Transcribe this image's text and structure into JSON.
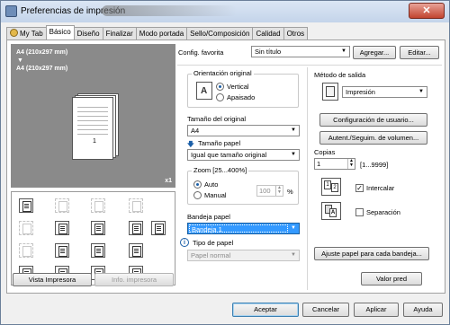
{
  "window": {
    "title": "Preferencias de impresión",
    "close_glyph": "✕"
  },
  "tabs": [
    {
      "label": "My Tab"
    },
    {
      "label": "Básico"
    },
    {
      "label": "Diseño"
    },
    {
      "label": "Finalizar"
    },
    {
      "label": "Modo portada"
    },
    {
      "label": "Sello/Composición"
    },
    {
      "label": "Calidad"
    },
    {
      "label": "Otros"
    }
  ],
  "preview": {
    "paper_line1": "A4 (210x297 mm)",
    "arrow": "▼",
    "paper_line2": "A4 (210x297 mm)",
    "page_number": "1",
    "copies_badge": "x1"
  },
  "left_buttons": {
    "printer_view": "Vista Impresora",
    "printer_info": "Info. impresora"
  },
  "favorite": {
    "label": "Config. favorita",
    "value": "Sin título",
    "add": "Agregar...",
    "edit": "Editar..."
  },
  "orientation": {
    "legend": "Orientación original",
    "vertical": "Vertical",
    "horizontal": "Apaisado",
    "selected": "vertical"
  },
  "original_size": {
    "label": "Tamaño del original",
    "value": "A4"
  },
  "paper_size": {
    "label": "Tamaño papel",
    "value": "Igual que tamaño original"
  },
  "zoom": {
    "legend": "Zoom [25...400%]",
    "auto": "Auto",
    "manual": "Manual",
    "value": "100",
    "unit": "%",
    "selected": "auto"
  },
  "tray": {
    "label": "Bandeja papel",
    "value": "Bandeja 1"
  },
  "paper_type": {
    "label": "Tipo de papel",
    "value": "Papel normal"
  },
  "output": {
    "label": "Método de salida",
    "value": "Impresión",
    "user_config": "Configuración de usuario...",
    "auth": "Autent./Seguim. de volumen..."
  },
  "copies": {
    "label": "Copias",
    "value": "1",
    "range": "[1...9999]",
    "collate_label": "Intercalar",
    "collate_checked": true,
    "separate_label": "Separación",
    "separate_checked": false
  },
  "adjust_button": "Ajuste papel para cada bandeja...",
  "default_button": "Valor pred",
  "bottom": {
    "ok": "Aceptar",
    "cancel": "Cancelar",
    "apply": "Aplicar",
    "help": "Ayuda"
  }
}
